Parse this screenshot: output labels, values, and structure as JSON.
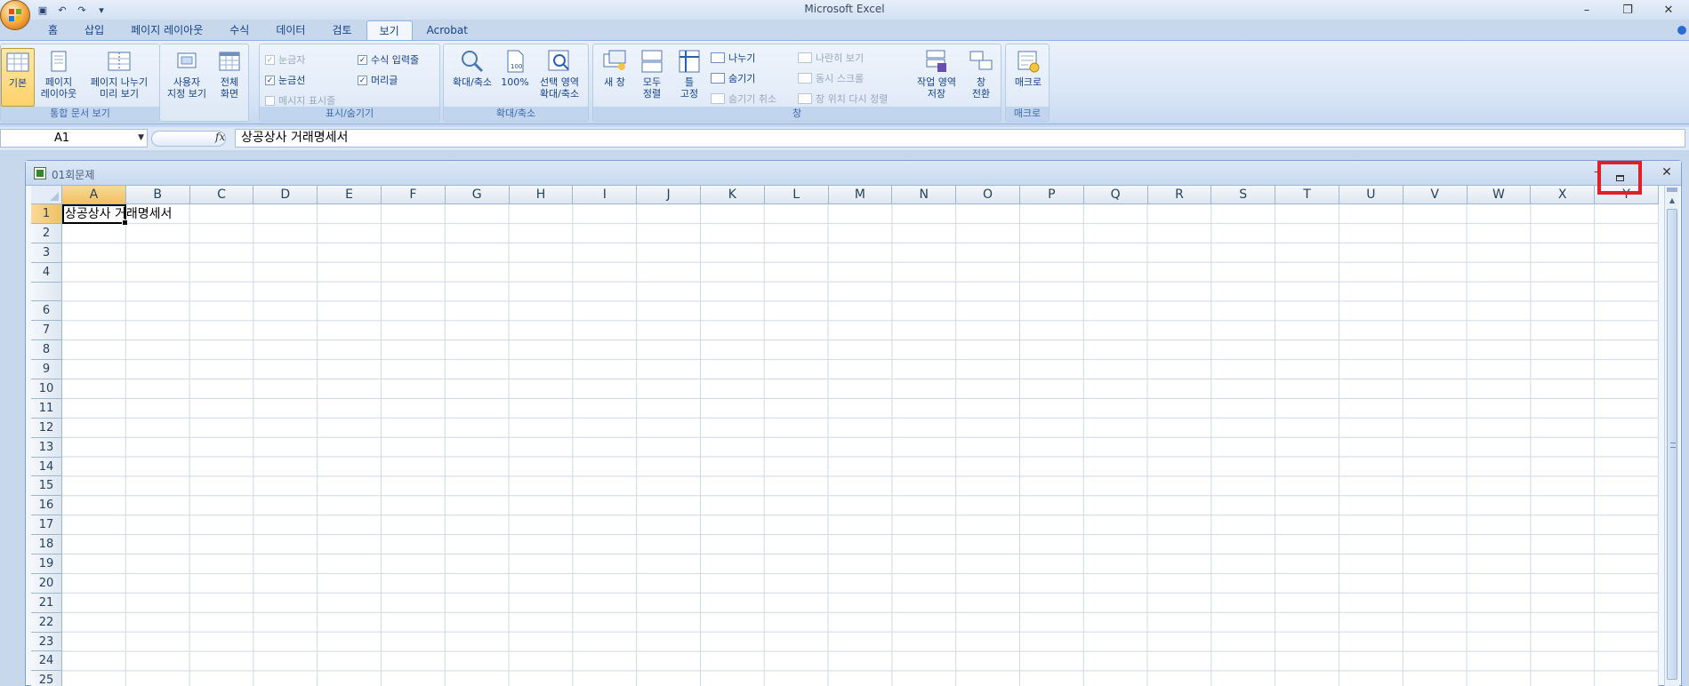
{
  "app": {
    "title": "Microsoft Excel",
    "window_controls": {
      "minimize": "–",
      "restore": "❐",
      "close": "✕"
    }
  },
  "quick_access": [
    {
      "name": "save-icon",
      "glyph": "▣"
    },
    {
      "name": "undo-icon",
      "glyph": "↶"
    },
    {
      "name": "redo-icon",
      "glyph": "↷"
    },
    {
      "name": "customize-icon",
      "glyph": "▾"
    }
  ],
  "tabs": [
    {
      "label": "홈",
      "active": false
    },
    {
      "label": "삽입",
      "active": false
    },
    {
      "label": "페이지 레이아웃",
      "active": false
    },
    {
      "label": "수식",
      "active": false
    },
    {
      "label": "데이터",
      "active": false
    },
    {
      "label": "검토",
      "active": false
    },
    {
      "label": "보기",
      "active": true
    },
    {
      "label": "Acrobat",
      "active": false
    }
  ],
  "ribbon": {
    "workbook_views": {
      "label": "통합 문서 보기",
      "normal": "기본",
      "page_layout_1": "페이지",
      "page_layout_2": "레이아웃",
      "page_break_1": "페이지 나누기",
      "page_break_2": "미리 보기",
      "custom_1": "사용자",
      "custom_2": "지정 보기",
      "full_1": "전체",
      "full_2": "화면"
    },
    "show_hide": {
      "label": "표시/숨기기",
      "ruler": "눈금자",
      "gridlines": "눈금선",
      "message_bar": "메시지 표시줄",
      "formula_bar": "수식 입력줄",
      "headings": "머리글",
      "check": "✓"
    },
    "zoom": {
      "label": "확대/축소",
      "zoom": "확대/축소",
      "hundred": "100%",
      "selection_1": "선택 영역",
      "selection_2": "확대/축소"
    },
    "window": {
      "label": "창",
      "new_window": "새 창",
      "arrange_1": "모두",
      "arrange_2": "정렬",
      "freeze_1": "틀",
      "freeze_2": "고정",
      "split": "나누기",
      "hide": "숨기기",
      "unhide": "숨기기 취소",
      "side_by_side": "나란히 보기",
      "sync_scroll": "동시 스크롤",
      "reset_position": "창 위치 다시 정렬",
      "save_ws_1": "작업 영역",
      "save_ws_2": "저장",
      "switch_1": "창",
      "switch_2": "전환"
    },
    "macros": {
      "label": "매크로",
      "macros": "매크로"
    }
  },
  "formula_bar": {
    "name_box": "A1",
    "fx": "fx",
    "content": "상공상사 거래명세서"
  },
  "workbook": {
    "name": "01회문제",
    "minimize": "–",
    "close": "✕"
  },
  "sheet": {
    "columns": [
      "A",
      "B",
      "C",
      "D",
      "E",
      "F",
      "G",
      "H",
      "I",
      "J",
      "K",
      "L",
      "M",
      "N",
      "O",
      "P",
      "Q",
      "R",
      "S",
      "T",
      "U",
      "V",
      "W",
      "X",
      "Y"
    ],
    "rows": [
      "1",
      "2",
      "3",
      "4",
      "",
      "6",
      "7",
      "8",
      "9",
      "10",
      "11",
      "12",
      "13",
      "14",
      "15",
      "16",
      "17",
      "18",
      "19",
      "20",
      "21",
      "22",
      "23",
      "24",
      "25"
    ],
    "selected_cell": "A1",
    "a1_value": "상공상사 거래명세서"
  }
}
